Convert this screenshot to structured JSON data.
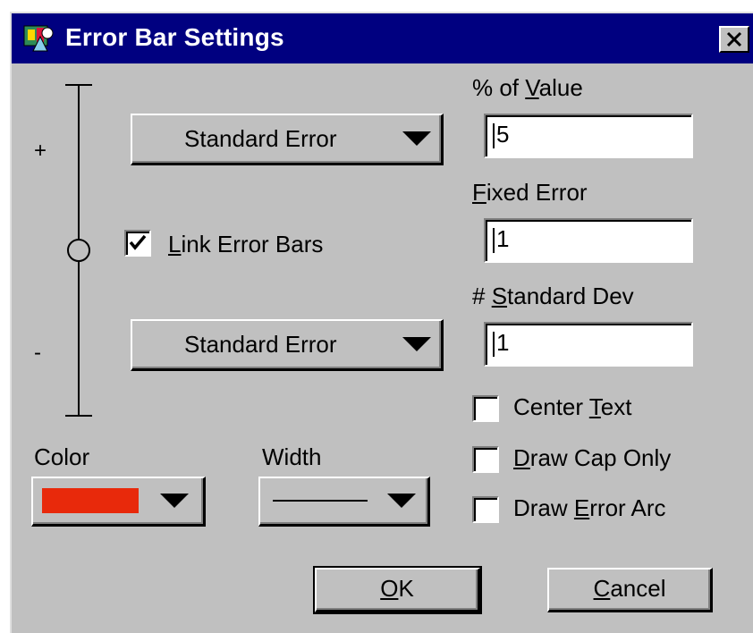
{
  "window": {
    "title": "Error Bar Settings",
    "close_symbol": "✕"
  },
  "slider": {
    "plus_label": "+",
    "minus_label": "-"
  },
  "upper_combo": {
    "value": "Standard Error"
  },
  "lower_combo": {
    "value": "Standard Error"
  },
  "link": {
    "label_prefix": "",
    "label_mnemonic": "L",
    "label_rest": "ink Error Bars",
    "checked": true
  },
  "percent": {
    "label_prefix": "% of ",
    "label_mnemonic": "V",
    "label_rest": "alue",
    "value": "5"
  },
  "fixed": {
    "label_prefix": "",
    "label_mnemonic": "F",
    "label_rest": "ixed Error",
    "value": "1"
  },
  "stddev": {
    "label_prefix": "# ",
    "label_mnemonic": "S",
    "label_rest": "tandard Dev",
    "value": "1"
  },
  "center_text": {
    "label_prefix": "Center ",
    "label_mnemonic": "T",
    "label_rest": "ext",
    "checked": false
  },
  "draw_cap": {
    "label_prefix": "",
    "label_mnemonic": "D",
    "label_rest": "raw Cap Only",
    "checked": false
  },
  "draw_arc": {
    "label_prefix": "Draw ",
    "label_mnemonic": "E",
    "label_rest": "rror Arc",
    "checked": false
  },
  "color": {
    "label": "Color",
    "swatch": "#e8290b"
  },
  "width": {
    "label": "Width"
  },
  "ok": {
    "label_mnemonic": "O",
    "label_rest": "K"
  },
  "cancel": {
    "label_prefix": "",
    "label_mnemonic": "C",
    "label_rest": "ancel"
  }
}
